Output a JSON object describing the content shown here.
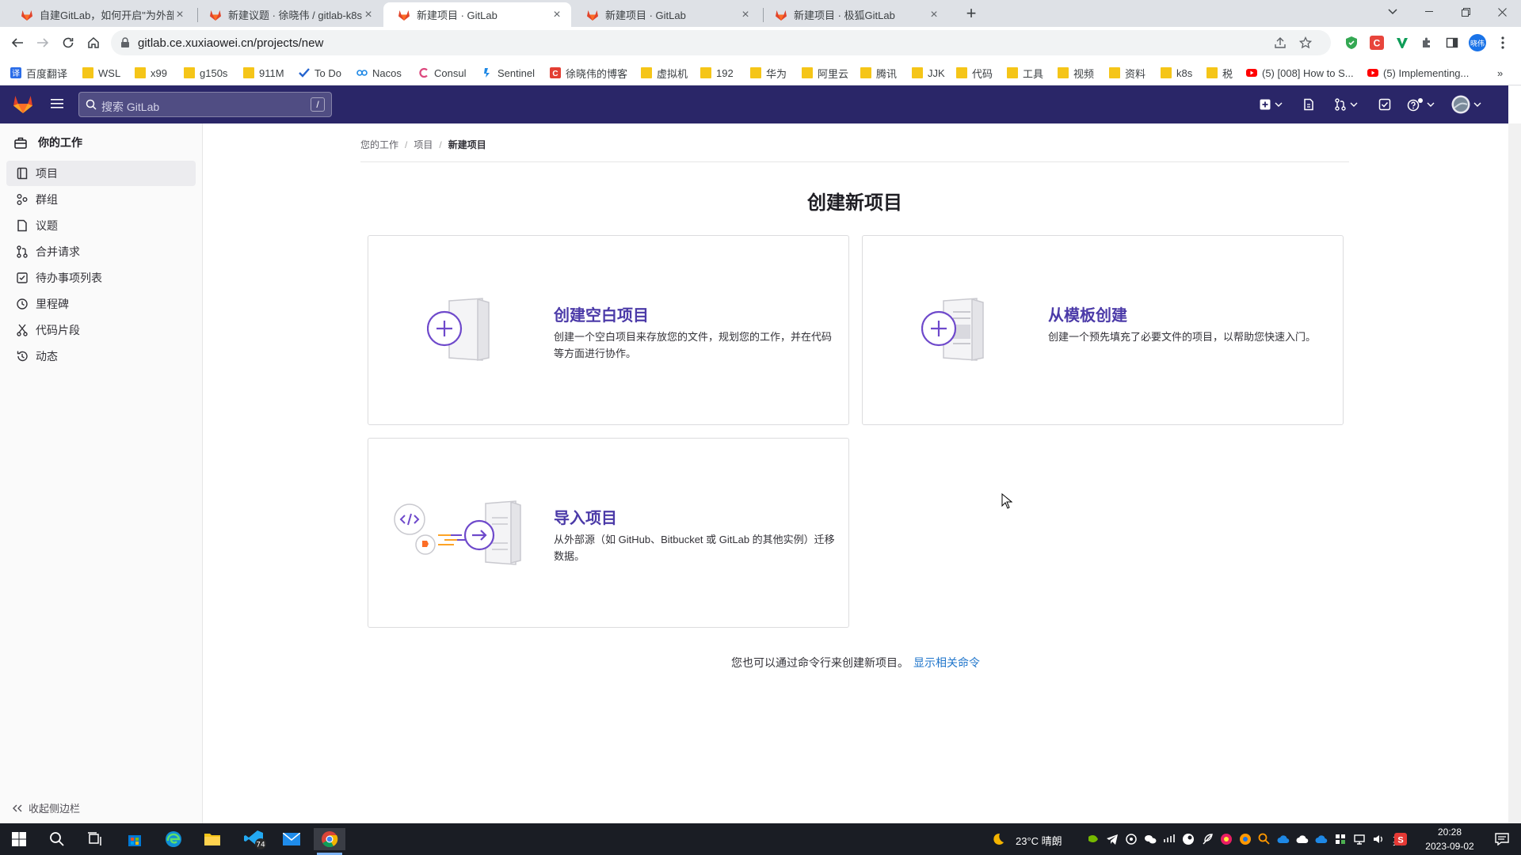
{
  "browser": {
    "tabs": [
      {
        "title": "自建GitLab，如何开启\"为外部合…",
        "active": false
      },
      {
        "title": "新建议题 · 徐晓伟 / gitlab-k8s ·",
        "active": false
      },
      {
        "title": "新建项目 · GitLab",
        "active": true
      },
      {
        "title": "新建项目 · GitLab",
        "active": false
      },
      {
        "title": "新建项目 · 极狐GitLab",
        "active": false
      }
    ],
    "url": "gitlab.ce.xuxiaowei.cn/projects/new",
    "bookmarks": [
      {
        "label": "百度翻译",
        "icon": "translate-icon"
      },
      {
        "label": "WSL",
        "icon": "folder-icon"
      },
      {
        "label": "x99",
        "icon": "folder-icon"
      },
      {
        "label": "g150s",
        "icon": "folder-icon"
      },
      {
        "label": "911M",
        "icon": "folder-icon"
      },
      {
        "label": "To Do",
        "icon": "check-icon"
      },
      {
        "label": "Nacos",
        "icon": "nacos-icon"
      },
      {
        "label": "Consul",
        "icon": "consul-icon"
      },
      {
        "label": "Sentinel",
        "icon": "sentinel-icon"
      },
      {
        "label": "徐晓伟的博客",
        "icon": "blog-icon"
      },
      {
        "label": "虚拟机",
        "icon": "folder-icon"
      },
      {
        "label": "192",
        "icon": "folder-icon"
      },
      {
        "label": "华为",
        "icon": "folder-icon"
      },
      {
        "label": "阿里云",
        "icon": "folder-icon"
      },
      {
        "label": "腾讯",
        "icon": "folder-icon"
      },
      {
        "label": "JJK",
        "icon": "folder-icon"
      },
      {
        "label": "代码",
        "icon": "folder-icon"
      },
      {
        "label": "工具",
        "icon": "folder-icon"
      },
      {
        "label": "视频",
        "icon": "folder-icon"
      },
      {
        "label": "资料",
        "icon": "folder-icon"
      },
      {
        "label": "k8s",
        "icon": "folder-icon"
      },
      {
        "label": "税",
        "icon": "folder-icon"
      },
      {
        "label": "(5) [008] How to S...",
        "icon": "youtube-icon"
      },
      {
        "label": "(5) Implementing...",
        "icon": "youtube-icon"
      }
    ],
    "profile_label": "晓伟"
  },
  "gitlab": {
    "search_placeholder": "搜索 GitLab",
    "search_shortcut": "/",
    "sidebar": {
      "header": "你的工作",
      "items": [
        {
          "label": "项目",
          "icon": "project-icon",
          "active": true
        },
        {
          "label": "群组",
          "icon": "group-icon",
          "active": false
        },
        {
          "label": "议题",
          "icon": "issues-icon",
          "active": false
        },
        {
          "label": "合并请求",
          "icon": "merge-request-icon",
          "active": false
        },
        {
          "label": "待办事项列表",
          "icon": "todo-icon",
          "active": false
        },
        {
          "label": "里程碑",
          "icon": "milestone-icon",
          "active": false
        },
        {
          "label": "代码片段",
          "icon": "snippet-icon",
          "active": false
        },
        {
          "label": "动态",
          "icon": "activity-icon",
          "active": false
        }
      ],
      "collapse_label": "收起侧边栏"
    },
    "breadcrumb": [
      "您的工作",
      "项目",
      "新建项目"
    ],
    "page_title": "创建新项目",
    "cards": [
      {
        "title": "创建空白项目",
        "description": "创建一个空白项目来存放您的文件，规划您的工作，并在代码等方面进行协作。"
      },
      {
        "title": "从模板创建",
        "description": "创建一个预先填充了必要文件的项目，以帮助您快速入门。"
      },
      {
        "title": "导入项目",
        "description": "从外部源（如 GitHub、Bitbucket 或 GitLab 的其他实例）迁移数据。"
      }
    ],
    "cli_note": "您也可以通过命令行来创建新项目。",
    "cli_link": "显示相关命令"
  },
  "taskbar": {
    "edge_badge": "74",
    "weather": "23°C  晴朗",
    "ime": "英",
    "time": "20:28",
    "date": "2023-09-02"
  },
  "colors": {
    "gitlab_nav": "#2a2668",
    "accent_purple": "#4b3aa8",
    "link_blue": "#1f75cb"
  }
}
